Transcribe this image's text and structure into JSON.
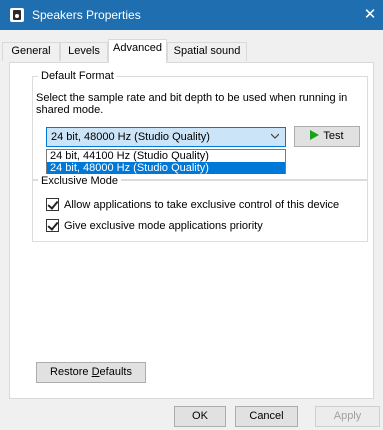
{
  "window": {
    "title": "Speakers Properties",
    "close_glyph": "✕"
  },
  "tabs": [
    {
      "label": "General"
    },
    {
      "label": "Levels"
    },
    {
      "label": "Advanced"
    },
    {
      "label": "Spatial sound"
    }
  ],
  "default_format": {
    "legend": "Default Format",
    "description": "Select the sample rate and bit depth to be used when running in shared mode.",
    "selected_value": "24 bit, 48000 Hz (Studio Quality)",
    "options": [
      "24 bit, 44100 Hz (Studio Quality)",
      "24 bit, 48000 Hz (Studio Quality)"
    ],
    "test_label": "Test"
  },
  "exclusive_mode": {
    "legend": "Exclusive Mode",
    "allow_label": "Allow applications to take exclusive control of this device",
    "priority_label": "Give exclusive mode applications priority"
  },
  "buttons": {
    "restore_prefix": "Restore ",
    "restore_underlined": "D",
    "restore_suffix": "efaults",
    "ok": "OK",
    "cancel": "Cancel",
    "apply": "Apply"
  },
  "colors": {
    "titlebar": "#1f6fb0",
    "accent": "#0078d7",
    "play": "#18a318"
  }
}
